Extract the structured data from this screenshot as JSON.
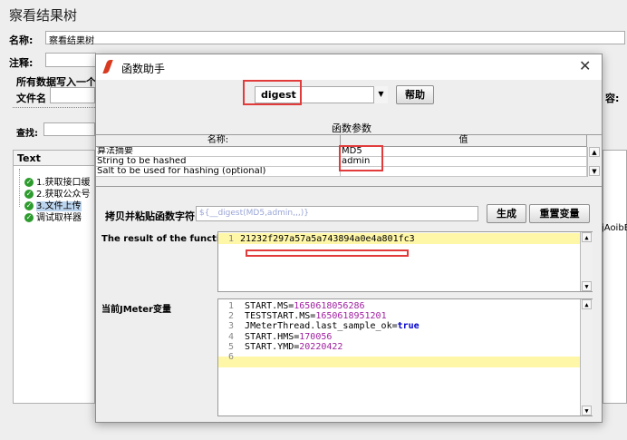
{
  "background": {
    "title": "察看结果树",
    "name_label": "名称:",
    "name_value": "察看结果树",
    "comment_label": "注释:",
    "write_all_label": "所有数据写入一个",
    "filename_label": "文件名",
    "search_label": "查找:",
    "text_header": "Text",
    "content_label": "容:",
    "right_fragment": "jAoibB",
    "tree_items": [
      {
        "label": "1.获取接口缓"
      },
      {
        "label": "2.获取公众号"
      },
      {
        "label": "3.文件上传"
      },
      {
        "label": "调试取样器"
      }
    ]
  },
  "dialog": {
    "title": "函数助手",
    "function_select": "digest",
    "help_button": "帮助",
    "params_title": "函数参数",
    "table": {
      "headers": [
        "名称:",
        "值"
      ],
      "rows": [
        {
          "name": "算法摘要",
          "value": "MD5"
        },
        {
          "name": "String to be hashed",
          "value": "admin"
        },
        {
          "name": "Salt to be used for hashing (optional)",
          "value": ""
        }
      ]
    },
    "copy_label": "拷贝并粘贴函数字符串",
    "function_string": "${__digest(MD5,admin,,,)}",
    "generate_button": "生成",
    "reset_button": "重置变量",
    "result_label": "The result of the function is",
    "result_lines": [
      {
        "num": "1",
        "text": "21232f297a57a5a743894a0e4a801fc3"
      }
    ],
    "vars_label": "当前JMeter变量",
    "var_lines": [
      {
        "num": "1",
        "key": "START.MS=",
        "val": "1650618056286",
        "type": "num"
      },
      {
        "num": "2",
        "key": "TESTSTART.MS=",
        "val": "1650618951201",
        "type": "num"
      },
      {
        "num": "3",
        "key": "JMeterThread.last_sample_ok=",
        "val": "true",
        "type": "kw"
      },
      {
        "num": "4",
        "key": "START.HMS=",
        "val": "170056",
        "type": "num"
      },
      {
        "num": "5",
        "key": "START.YMD=",
        "val": "20220422",
        "type": "num"
      },
      {
        "num": "6",
        "key": "",
        "val": "",
        "type": "num"
      }
    ]
  },
  "colors": {
    "highlight_box": "#e23b3b",
    "current_line": "#fff7a8",
    "number_literal": "#a020a0",
    "keyword": "#0000cc"
  }
}
